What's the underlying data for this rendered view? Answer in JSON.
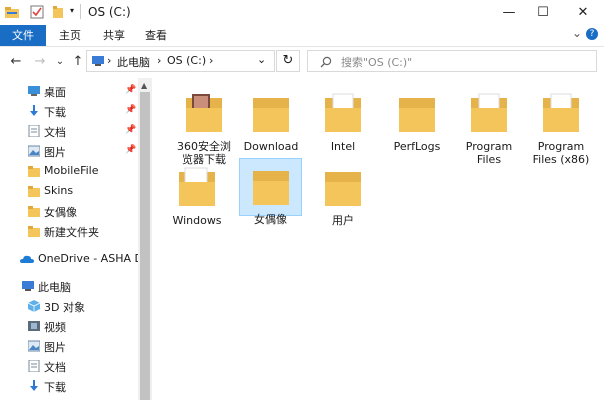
{
  "window": {
    "title": "OS (C:)",
    "controls": {
      "minimize": "—",
      "maximize": "☐",
      "close": "✕"
    },
    "qat_expand": "▾"
  },
  "ribbon": {
    "tabs": [
      "文件",
      "主页",
      "共享",
      "查看"
    ],
    "collapse": "⌄",
    "help": "?"
  },
  "nav": {
    "back": "←",
    "forward": "→",
    "recent": "⌄",
    "up": "↑",
    "address": {
      "segments": [
        "此电脑",
        "OS (C:)"
      ],
      "sep": "›",
      "dropdown": "⌄"
    },
    "refresh": "↻",
    "search_placeholder": "搜索\"OS (C:)\""
  },
  "sidebar": {
    "items": [
      {
        "label": "桌面",
        "icon": "desktop-icon",
        "pinned": true
      },
      {
        "label": "下载",
        "icon": "download-icon",
        "pinned": true
      },
      {
        "label": "文档",
        "icon": "document-icon",
        "pinned": true
      },
      {
        "label": "图片",
        "icon": "picture-icon",
        "pinned": true
      },
      {
        "label": "MobileFile",
        "icon": "folder-icon",
        "pinned": false
      },
      {
        "label": "Skins",
        "icon": "folder-icon",
        "pinned": false
      },
      {
        "label": "女偶像",
        "icon": "folder-icon",
        "pinned": false
      },
      {
        "label": "新建文件夹",
        "icon": "folder-icon",
        "pinned": false
      },
      {
        "label": "OneDrive - ASHA DE",
        "icon": "onedrive-icon",
        "pinned": false
      },
      {
        "label": "此电脑",
        "icon": "computer-icon",
        "pinned": false
      },
      {
        "label": "3D 对象",
        "icon": "3d-objects-icon",
        "pinned": false
      },
      {
        "label": "视频",
        "icon": "video-icon",
        "pinned": false
      },
      {
        "label": "图片",
        "icon": "picture-icon",
        "pinned": false
      },
      {
        "label": "文档",
        "icon": "document-icon",
        "pinned": false
      },
      {
        "label": "下载",
        "icon": "download-icon",
        "pinned": false
      }
    ],
    "pin_glyph": "📌"
  },
  "files": [
    {
      "label": "360安全浏\n览器下载",
      "selected": false
    },
    {
      "label": "Download",
      "selected": false
    },
    {
      "label": "Intel",
      "selected": false
    },
    {
      "label": "PerfLogs",
      "selected": false
    },
    {
      "label": "Program\nFiles",
      "selected": false
    },
    {
      "label": "Program\nFiles (x86)",
      "selected": false
    },
    {
      "label": "Windows",
      "selected": false
    },
    {
      "label": "女偶像",
      "selected": true
    },
    {
      "label": "用户",
      "selected": false
    }
  ],
  "colors": {
    "accent": "#1a6dc4",
    "folder": "#f3c55b",
    "selection": "#cce8ff"
  }
}
